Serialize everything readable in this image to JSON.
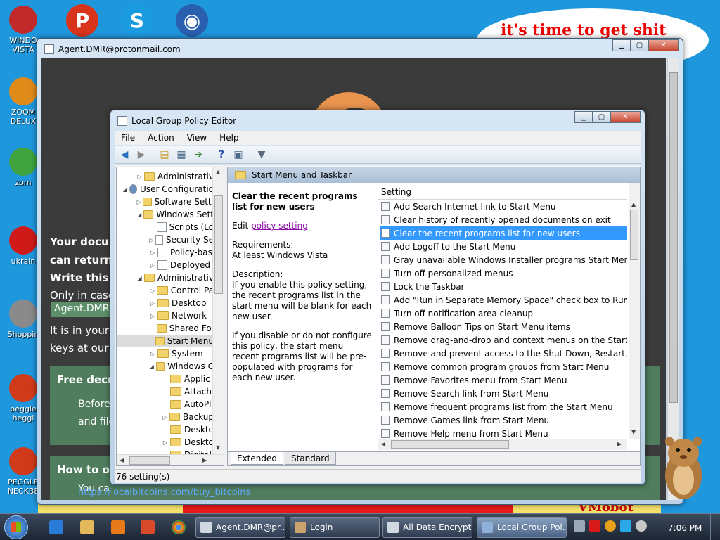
{
  "desktop": {
    "bubble_text": "it's time to get shit",
    "strip_right_text": "VMobot",
    "icons": [
      {
        "label1": "WINDO",
        "label2": "VISTA",
        "icon": "chrome-ball-icon",
        "color": "#c02a2a"
      },
      {
        "label1": "ZOOM",
        "label2": "DELUX",
        "icon": "zoom-icon",
        "color": "#e08a1a"
      },
      {
        "label1": "zom",
        "label2": "",
        "icon": "flower-icon",
        "color": "#3fa33f"
      },
      {
        "label1": "ukrain",
        "label2": "",
        "icon": "radiation-icon",
        "color": "#d01a1a"
      },
      {
        "label1": "Shoppin",
        "label2": "",
        "icon": "flash-icon",
        "color": "#8a8a8a"
      },
      {
        "label1": "peggle",
        "label2": "heggl",
        "icon": "peggle-icon",
        "color": "#d03a1a"
      },
      {
        "label1": "PEGGLE",
        "label2": "NECKBE",
        "icon": "peggle-icon",
        "color": "#d03a1a"
      }
    ],
    "top_icons": [
      {
        "icon": "peggle-icon",
        "glyph": "P",
        "color": "#d8341c"
      },
      {
        "icon": "skype-icon",
        "glyph": "S",
        "color": "#1a9be0"
      },
      {
        "icon": "globe-icon",
        "glyph": "◉",
        "color": "#2a5fb0"
      }
    ]
  },
  "background_window": {
    "title": "Agent.DMR@protonmail.com",
    "lines": {
      "l1": "Your docum",
      "l2": "can return a",
      "l3": "Write this I",
      "l4": "Only in case",
      "email": "Agent.DMR@",
      "l5": "It is in your in",
      "l6": "keys at our s"
    },
    "panel1": {
      "heading": "Free decry",
      "t1": "Before",
      "t2": "and file"
    },
    "panel2": {
      "heading": "How to ob",
      "t1": "You ca"
    },
    "link": "https://localbitcoins.com/buy_bitcoins"
  },
  "gpedit": {
    "title": "Local Group Policy Editor",
    "menu": [
      "File",
      "Action",
      "View",
      "Help"
    ],
    "tree": [
      {
        "label": "Administrativ",
        "indent": 28,
        "arrow": "▷",
        "type": "folder"
      },
      {
        "label": "User Configuratio",
        "indent": 8,
        "arrow": "◢",
        "type": "user"
      },
      {
        "label": "Software Setti",
        "indent": 28,
        "arrow": "▷",
        "type": "folder"
      },
      {
        "label": "Windows Sett",
        "indent": 28,
        "arrow": "◢",
        "type": "folder"
      },
      {
        "label": "Scripts (Lo",
        "indent": 46,
        "arrow": "",
        "type": "doc"
      },
      {
        "label": "Security Se",
        "indent": 46,
        "arrow": "▷",
        "type": "doc"
      },
      {
        "label": "Policy-bas",
        "indent": 46,
        "arrow": "▷",
        "type": "doc"
      },
      {
        "label": "Deployed",
        "indent": 46,
        "arrow": "▷",
        "type": "doc"
      },
      {
        "label": "Administrativ",
        "indent": 28,
        "arrow": "◢",
        "type": "folder"
      },
      {
        "label": "Control Pa",
        "indent": 46,
        "arrow": "▷",
        "type": "folder"
      },
      {
        "label": "Desktop",
        "indent": 46,
        "arrow": "▷",
        "type": "folder"
      },
      {
        "label": "Network",
        "indent": 46,
        "arrow": "▷",
        "type": "folder"
      },
      {
        "label": "Shared Fol",
        "indent": 46,
        "arrow": "",
        "type": "folder"
      },
      {
        "label": "Start Menu",
        "indent": 46,
        "arrow": "",
        "type": "folder",
        "selected": true
      },
      {
        "label": "System",
        "indent": 46,
        "arrow": "▷",
        "type": "folder"
      },
      {
        "label": "Windows C",
        "indent": 46,
        "arrow": "◢",
        "type": "folder"
      },
      {
        "label": "Applic",
        "indent": 64,
        "arrow": "",
        "type": "folder"
      },
      {
        "label": "Attach",
        "indent": 64,
        "arrow": "",
        "type": "folder"
      },
      {
        "label": "AutoPl",
        "indent": 64,
        "arrow": "",
        "type": "folder"
      },
      {
        "label": "Backup",
        "indent": 64,
        "arrow": "▷",
        "type": "folder"
      },
      {
        "label": "Deskto",
        "indent": 64,
        "arrow": "",
        "type": "folder"
      },
      {
        "label": "Deskto",
        "indent": 64,
        "arrow": "▷",
        "type": "folder"
      },
      {
        "label": "Digital",
        "indent": 64,
        "arrow": "",
        "type": "folder"
      }
    ],
    "right_header": "Start Menu and Taskbar",
    "desc": {
      "title": "Clear the recent programs list for new users",
      "edit_prefix": "Edit ",
      "edit_link": "policy setting ",
      "req_label": "Requirements:",
      "req_value": "At least Windows Vista",
      "desc_label": "Description:",
      "desc_p1": "If you enable this policy setting, the recent programs list in the start menu will be blank for each new user.",
      "desc_p2": "If you disable or do not configure this policy, the start menu recent programs list will be pre-populated with programs for each new user."
    },
    "column_header": "Setting",
    "settings": [
      "Add Search Internet link to Start Menu",
      "Clear history of recently opened documents on exit",
      "Clear the recent programs list for new users",
      "Add Logoff to the Start Menu",
      "Gray unavailable Windows Installer programs Start Menu sh...",
      "Turn off personalized menus",
      "Lock the Taskbar",
      "Add \"Run in Separate Memory Space\" check box to Run dial...",
      "Turn off notification area cleanup",
      "Remove Balloon Tips on Start Menu items",
      "Remove drag-and-drop and context menus on the Start Me...",
      "Remove and prevent access to the Shut Down, Restart, Sleep...",
      "Remove common program groups from Start Menu",
      "Remove Favorites menu from Start Menu",
      "Remove Search link from Start Menu",
      "Remove frequent programs list from the Start Menu",
      "Remove Games link from Start Menu",
      "Remove Help menu from Start Menu"
    ],
    "selected_index": 2,
    "tabs": [
      "Extended",
      "Standard"
    ],
    "status": "76 setting(s)"
  },
  "taskbar": {
    "tasks": [
      {
        "label": "Agent.DMR@pr...",
        "icon": "window-icon",
        "color": "#d0d8e0"
      },
      {
        "label": "Login",
        "icon": "user-icon",
        "color": "#c9a36b"
      },
      {
        "label": "All Data Encrypt...",
        "icon": "window-icon",
        "color": "#d0d8e0"
      },
      {
        "label": "Local Group Pol...",
        "icon": "gpedit-icon",
        "color": "#8fb0d8"
      }
    ],
    "clock": "7:06 PM"
  },
  "colors": {
    "selection": "#3399ff",
    "link": "#8b0aa8"
  }
}
